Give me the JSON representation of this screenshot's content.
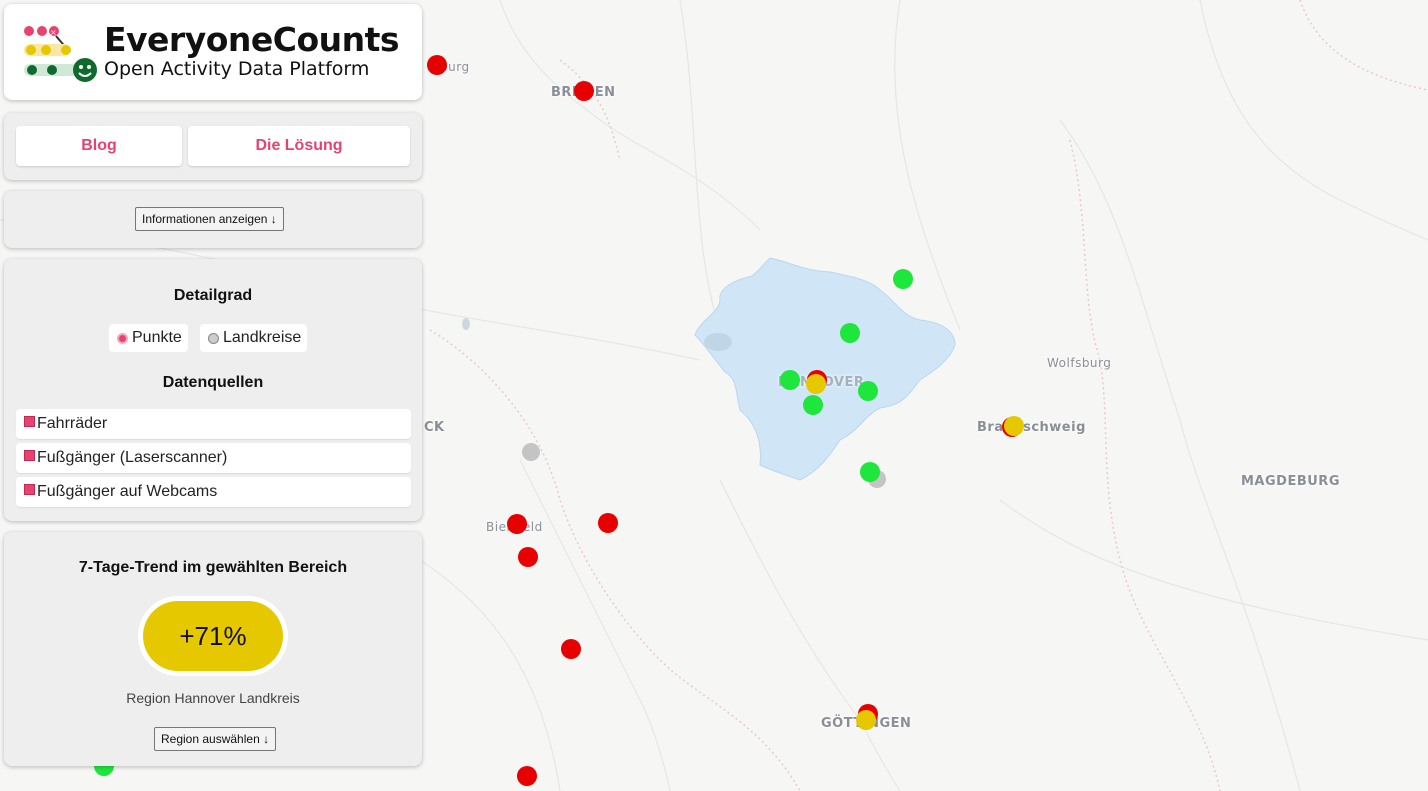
{
  "brand": {
    "title": "EveryoneCounts",
    "subtitle": "Open Activity Data Platform"
  },
  "nav": {
    "blog_label": "Blog",
    "solution_label": "Die Lösung"
  },
  "info": {
    "toggle_label": "Informationen anzeigen ↓"
  },
  "filters": {
    "detail_heading": "Detailgrad",
    "detail_options": [
      {
        "label": "Punkte",
        "selected": true
      },
      {
        "label": "Landkreise",
        "selected": false
      }
    ],
    "sources_heading": "Datenquellen",
    "sources": [
      {
        "label": "Fahrräder",
        "checked": true
      },
      {
        "label": "Fußgänger (Laserscanner)",
        "checked": true
      },
      {
        "label": "Fußgänger auf Webcams",
        "checked": true
      }
    ]
  },
  "trend": {
    "heading": "7-Tage-Trend im gewählten Bereich",
    "value": "+71%",
    "region": "Region Hannover Landkreis",
    "region_button": "Region auswählen ↓",
    "color": "#e6c800"
  },
  "map": {
    "cities": {
      "hamburg": "burg",
      "bremen": "BREMEN",
      "hannover": "HANNOVER",
      "wolfsburg": "Wolfsburg",
      "braunschweig": "Braunschweig",
      "magdeburg": "MAGDEBURG",
      "osnabrueck": "CK",
      "bielefeld": "Bielefeld",
      "goettingen": "GÖTTINGEN"
    },
    "highlight_region": "Region Hannover",
    "colors": {
      "decline": "#e60000",
      "increase": "#1ee63c",
      "slight": "#e6c800",
      "no_data": "#c4c4c4",
      "region_fill": "#cfe6f7",
      "brand_pink": "#e8426f"
    }
  }
}
